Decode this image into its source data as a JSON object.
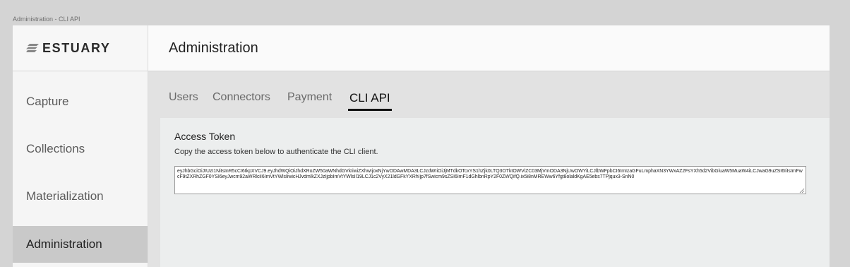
{
  "window": {
    "title": "Administration - CLI API"
  },
  "brand": {
    "name": "ESTUARY"
  },
  "sidebar": {
    "items": [
      {
        "label": "Capture",
        "active": false
      },
      {
        "label": "Collections",
        "active": false
      },
      {
        "label": "Materialization",
        "active": false
      },
      {
        "label": "Administration",
        "active": true
      }
    ]
  },
  "header": {
    "title": "Administration"
  },
  "tabs": [
    {
      "label": "Users",
      "active": false
    },
    {
      "label": "Connectors",
      "active": false
    },
    {
      "label": "Payment",
      "active": false
    },
    {
      "label": "CLI API",
      "active": true
    }
  ],
  "access_token": {
    "title": "Access Token",
    "description": "Copy the access token below to authenticate the CLI client.",
    "value": "eyJhbGciOiJIUzI1NiIsInR5cCI6IkpXVCJ9.eyJhdWQiOiJhdXRoZW50aWNhdGVkIiwiZXhwIjoxNjYwODAwMDA3LCJzdWIiOiJjMTdkOTcxYS1hZjk0LTQ3OTktOWViZC03MjVmODA3NjUwOWYiLCJlbWFpbCI6ImIzaGFuLmphaXN3YWxAZ2FsYXh5d2VibGluaW5MuaW4iLCJwaG9uZSI6IiIsImFwcF9tZXRhZGF0YSI6eyJwcm92aWRlciI6ImVtYWlsIiwicHJvdmlkZXJzIjpbImVtYWlsIl19LCJ1c2VyX21ldGFkYXRhIjp7fSwicm9sZSI6ImF1dGhlbnRpY2F0ZWQifQ.ix5i8nMREWw6Yfgt8olaldKgAE5ebs7TPjqux3-SnN0"
  },
  "colors": {
    "sidebar_active": "#c9c9c9",
    "tab_underline": "#111111",
    "content_bg": "#e2e2e2"
  }
}
